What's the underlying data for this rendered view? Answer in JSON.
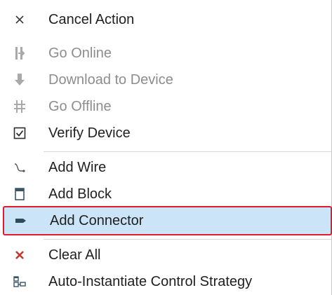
{
  "menu": {
    "items": [
      {
        "label": "Cancel Action",
        "icon": "close-icon",
        "enabled": true
      },
      {
        "label": "Go Online",
        "icon": "go-online-icon",
        "enabled": false
      },
      {
        "label": "Download to Device",
        "icon": "download-icon",
        "enabled": false
      },
      {
        "label": "Go Offline",
        "icon": "go-offline-icon",
        "enabled": false
      },
      {
        "label": "Verify Device",
        "icon": "checkbox-check-icon",
        "enabled": true
      },
      {
        "label": "Add Wire",
        "icon": "wire-icon",
        "enabled": true
      },
      {
        "label": "Add Block",
        "icon": "block-icon",
        "enabled": true
      },
      {
        "label": "Add Connector",
        "icon": "connector-icon",
        "enabled": true,
        "highlighted": true
      },
      {
        "label": "Clear All",
        "icon": "clear-icon",
        "enabled": true
      },
      {
        "label": "Auto-Instantiate Control Strategy",
        "icon": "auto-instantiate-icon",
        "enabled": true
      }
    ]
  },
  "colors": {
    "highlight_bg": "#cce4f7",
    "highlight_border": "#e21a2c",
    "clear_icon": "#c0392b",
    "disabled_text": "#8d8d8d"
  }
}
